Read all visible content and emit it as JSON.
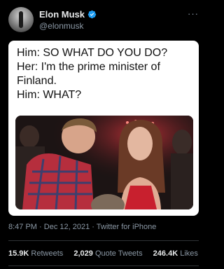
{
  "colors": {
    "background": "#000000",
    "text_primary": "#e7e9ea",
    "text_secondary": "#8b98a5",
    "verified_badge": "#1d9bf0",
    "card_background": "#ffffff"
  },
  "author": {
    "name": "Elon Musk",
    "handle": "@elonmusk",
    "verified_icon": "verified-badge-icon",
    "more_icon": "more-options-icon",
    "more_label": "···"
  },
  "tweet": {
    "lines": [
      "Him: SO WHAT DO YOU DO?",
      "Her: I'm the prime minister of",
      "Finland.",
      "Him: WHAT?"
    ]
  },
  "meta": {
    "time": "8:47 PM",
    "date": "Dec 12, 2021",
    "separator": "·",
    "source": "Twitter for iPhone"
  },
  "stats": {
    "retweets_count": "15.9K",
    "retweets_label": "Retweets",
    "quotes_count": "2,029",
    "quotes_label": "Quote Tweets",
    "likes_count": "246.4K",
    "likes_label": "Likes"
  }
}
